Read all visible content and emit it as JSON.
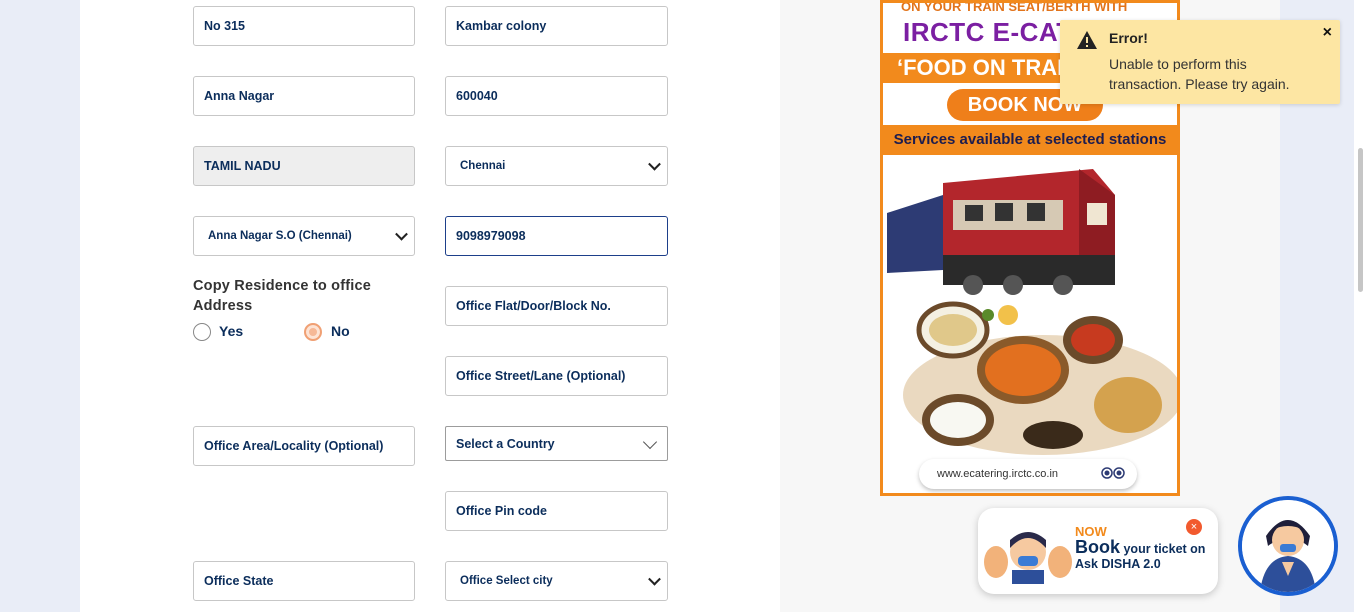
{
  "form": {
    "res_flat": "No 315",
    "res_street": "Kambar colony",
    "res_area": "Anna Nagar",
    "res_pin": "600040",
    "res_state": "TAMIL NADU",
    "res_city": "Chennai",
    "res_post_office": "Anna Nagar S.O (Chennai)",
    "mobile": "9098979098",
    "copy_label": "Copy Residence to office Address",
    "yes_label": "Yes",
    "no_label": "No",
    "copy_selected": "No",
    "office_flat_placeholder": "Office Flat/Door/Block No.",
    "office_street_placeholder": "Office Street/Lane (Optional)",
    "office_area_placeholder": "Office Area/Locality (Optional)",
    "country_select": "Select a Country",
    "office_pin_placeholder": "Office Pin code",
    "office_state_placeholder": "Office State",
    "office_city_select": "Office Select city"
  },
  "ad": {
    "top_line": "ON YOUR TRAIN SEAT/BERTH WITH",
    "brand": "IRCTC E-CATERING",
    "food_tagline": "‘FOOD ON TRAIN’",
    "book_button": "BOOK NOW",
    "services": "Services available at selected stations",
    "url": "www.ecatering.irctc.co.in"
  },
  "toast": {
    "title": "Error!",
    "message": "Unable to perform this transaction. Please try again.",
    "close": "×"
  },
  "disha": {
    "now": "NOW",
    "book": "Book",
    "rest": "your ticket on",
    "line2": "Ask DISHA 2.0",
    "close": "×"
  },
  "colors": {
    "accent_orange": "#f28a1c",
    "brand_purple": "#7b1fa2",
    "toast_bg": "#fde6a3",
    "navy_text": "#0b2d5b",
    "disha_ring": "#1a5fd1"
  }
}
